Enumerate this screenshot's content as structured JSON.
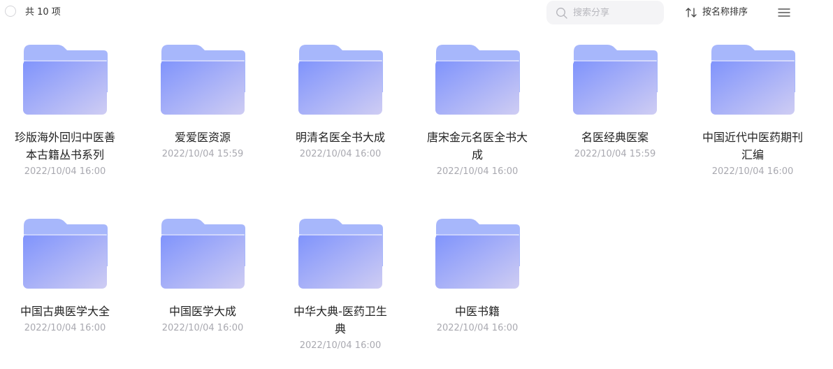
{
  "toolbar": {
    "count_label": "共 10 项",
    "search_placeholder": "搜索分享",
    "sort_label": "按名称排序"
  },
  "colors": {
    "folder_back": "#a7b7fb",
    "folder_front_start": "#7f93fc",
    "folder_front_end": "#cfcdf3",
    "text_primary": "#222222",
    "text_secondary": "#a9a9b0"
  },
  "items": [
    {
      "name": "珍版海外回归中医善本古籍丛书系列",
      "date": "2022/10/04 16:00"
    },
    {
      "name": "爱爱医资源",
      "date": "2022/10/04 15:59"
    },
    {
      "name": "明清名医全书大成",
      "date": "2022/10/04 16:00"
    },
    {
      "name": "唐宋金元名医全书大成",
      "date": "2022/10/04 16:00"
    },
    {
      "name": "名医经典医案",
      "date": "2022/10/04 15:59"
    },
    {
      "name": "中国近代中医药期刊汇编",
      "date": "2022/10/04 16:00"
    },
    {
      "name": "中国古典医学大全",
      "date": "2022/10/04 16:00"
    },
    {
      "name": "中国医学大成",
      "date": "2022/10/04 16:00"
    },
    {
      "name": "中华大典-医药卫生典",
      "date": "2022/10/04 16:00"
    },
    {
      "name": "中医书籍",
      "date": "2022/10/04 16:00"
    }
  ]
}
